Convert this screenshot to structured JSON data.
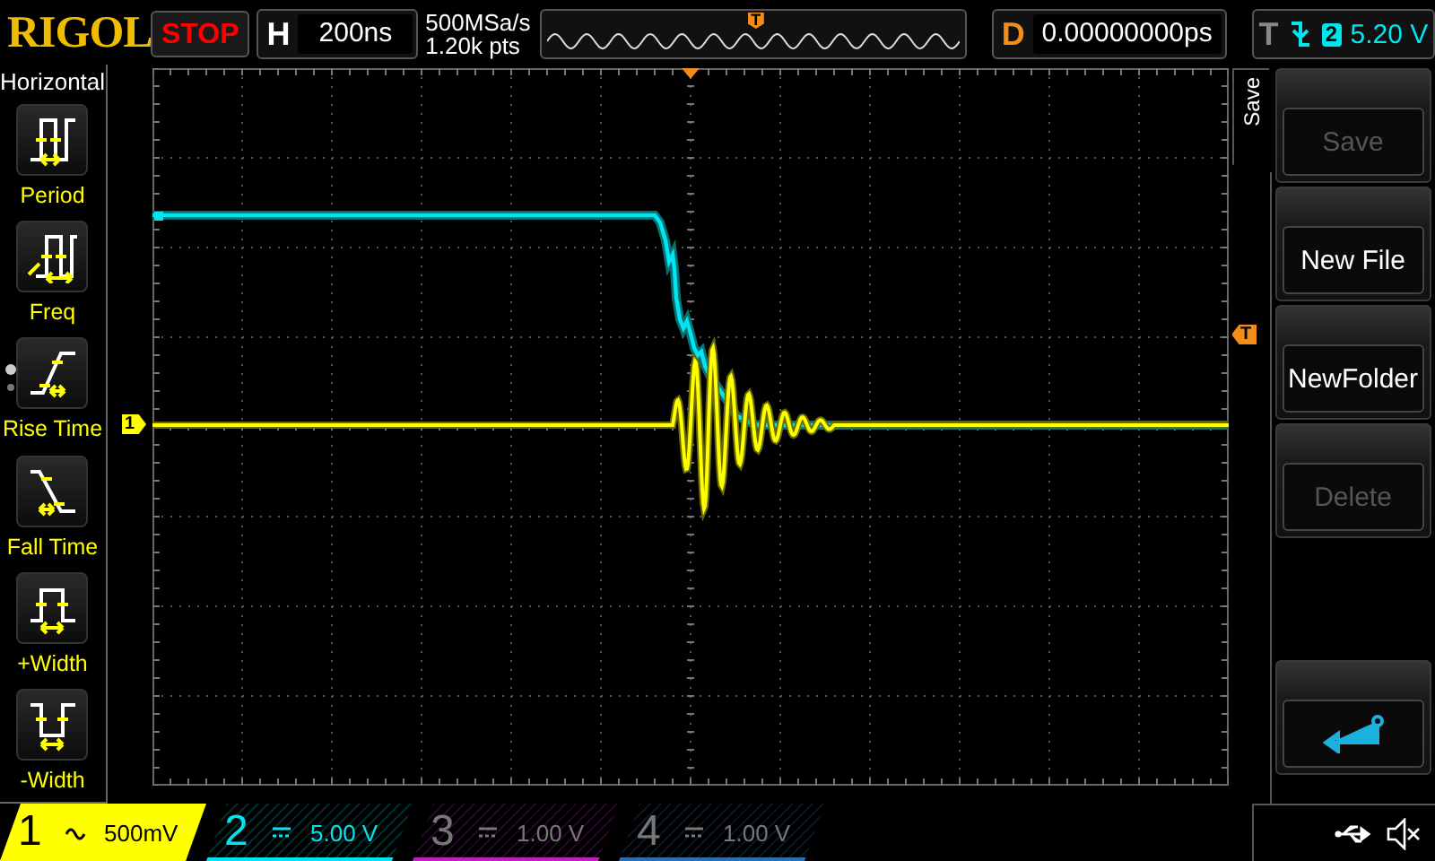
{
  "brand": "RIGOL",
  "run_state": "STOP",
  "timebase": {
    "label": "H",
    "value": "200ns"
  },
  "acquisition": {
    "sample_rate": "500MSa/s",
    "depth": "1.20k pts"
  },
  "memory_view": {
    "trigger_marker": "T"
  },
  "delay": {
    "label": "D",
    "value": "0.00000000ps"
  },
  "trigger": {
    "label": "T",
    "source": "2",
    "level": "5.20 V"
  },
  "left_menu": {
    "title": "Horizontal",
    "items": [
      {
        "label": "Period",
        "kind": "period"
      },
      {
        "label": "Freq",
        "kind": "freq"
      },
      {
        "label": "Rise Time",
        "kind": "rise"
      },
      {
        "label": "Fall Time",
        "kind": "fall"
      },
      {
        "label": "+Width",
        "kind": "pwidth"
      },
      {
        "label": "-Width",
        "kind": "nwidth"
      }
    ]
  },
  "grid_markers": {
    "channel_1": "1",
    "trigger_level": "T"
  },
  "right_menu": {
    "title": "Save",
    "buttons": [
      {
        "label": "Save",
        "disabled": true
      },
      {
        "label": "New File",
        "disabled": false
      },
      {
        "label": "NewFolder",
        "disabled": false
      },
      {
        "label": "Delete",
        "disabled": true
      }
    ]
  },
  "channels": [
    {
      "number": "1",
      "scale": "500mV",
      "selected": true,
      "on": true,
      "color": "#ffff00"
    },
    {
      "number": "2",
      "scale": "5.00 V",
      "selected": false,
      "on": true,
      "color": "#00e5ee"
    },
    {
      "number": "3",
      "scale": "1.00 V",
      "selected": false,
      "on": false,
      "color": "#c020c0"
    },
    {
      "number": "4",
      "scale": "1.00 V",
      "selected": false,
      "on": false,
      "color": "#2c6fb0"
    }
  ]
}
